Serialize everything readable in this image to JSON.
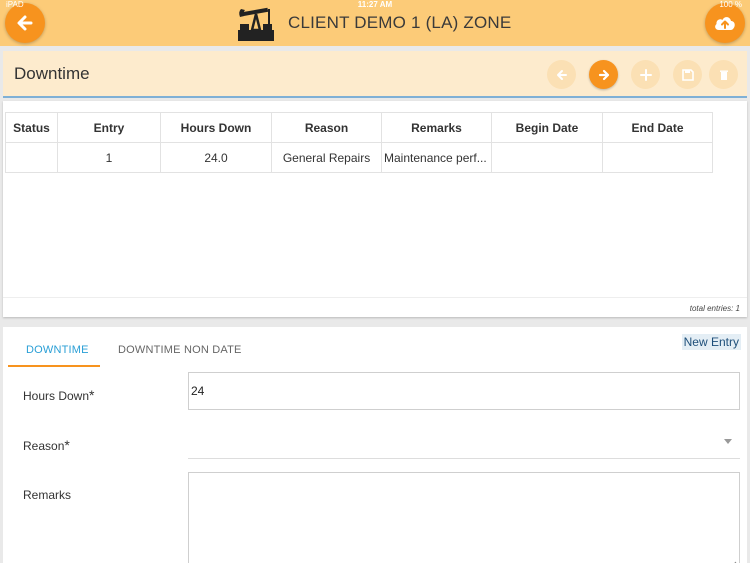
{
  "statusbar": {
    "carrier": "iPAD",
    "time": "11:27 AM",
    "battery": "100 %"
  },
  "header": {
    "title": "CLIENT DEMO 1 (LA) ZONE"
  },
  "section": {
    "title": "Downtime"
  },
  "table": {
    "columns": [
      "Status",
      "Entry",
      "Hours Down",
      "Reason",
      "Remarks",
      "Begin Date",
      "End Date"
    ],
    "rows": [
      [
        "",
        "1",
        "24.0",
        "General Repairs",
        "Maintenance perf...",
        "",
        ""
      ]
    ],
    "total": "total entries: 1"
  },
  "form": {
    "tabs": [
      {
        "label": "DOWNTIME",
        "active": true
      },
      {
        "label": "DOWNTIME NON DATE",
        "active": false
      }
    ],
    "new_entry": "New Entry",
    "hours_label": "Hours Down",
    "hours_value": "24",
    "reason_label": "Reason",
    "remarks_label": "Remarks",
    "required_mark": "*"
  },
  "colors": {
    "accent": "#f7931e",
    "header_bg": "#fccb78",
    "section_bg": "#fdebcd",
    "tab_active": "#2a9fd6"
  },
  "icons": {
    "back": "arrow-left-icon",
    "upload": "cloud-upload-icon",
    "logo": "oil-pump-icon",
    "prev": "arrow-left-icon",
    "next": "arrow-right-icon",
    "add": "plus-icon",
    "save": "floppy-icon",
    "delete": "trash-icon"
  }
}
